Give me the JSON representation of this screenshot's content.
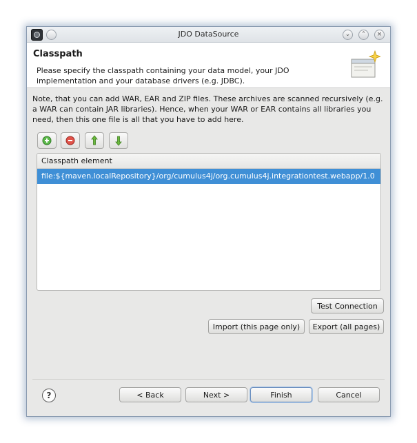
{
  "window": {
    "title": "JDO DataSource"
  },
  "header": {
    "title": "Classpath",
    "description": "Please specify the classpath containing your data model, your JDO implementation and your database drivers (e.g. JDBC)."
  },
  "note": "Note, that you can add WAR, EAR and ZIP files. These archives are scanned recursively (e.g. a WAR can contain JAR libraries). Hence, when your WAR or EAR contains all libraries you need, then this one file is all that you have to add here.",
  "toolbar": {
    "icons": [
      "add-icon",
      "remove-icon",
      "move-up-icon",
      "move-down-icon"
    ]
  },
  "table": {
    "column_header": "Classpath element",
    "rows": [
      "file:${maven.localRepository}/org/cumulus4j/org.cumulus4j.integrationtest.webapp/1.0"
    ]
  },
  "buttons": {
    "test_connection": "Test Connection",
    "import": "Import (this page only)",
    "export": "Export (all pages)",
    "back": "< Back",
    "next": "Next >",
    "finish": "Finish",
    "cancel": "Cancel"
  },
  "colors": {
    "selection": "#3f8fd6",
    "window_bg": "#e8e8e7"
  }
}
